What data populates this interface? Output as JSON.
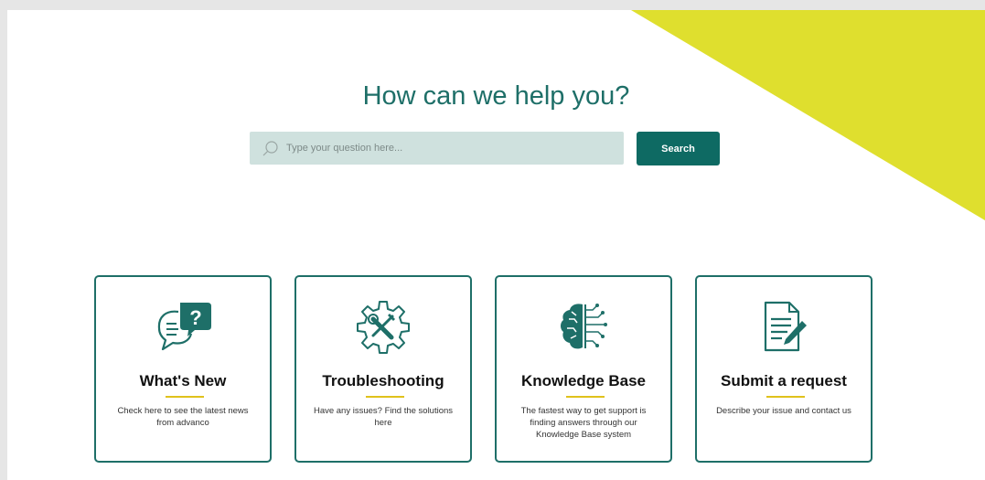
{
  "hero": {
    "title": "How can we help you?"
  },
  "search": {
    "placeholder": "Type your question here...",
    "button_label": "Search"
  },
  "colors": {
    "accent": "#dfdf2e",
    "brand": "#1e6f68",
    "button": "#0e6a63",
    "search_bg": "#cfe1de",
    "underline": "#e0c21c"
  },
  "cards": [
    {
      "icon": "chat-question-icon",
      "title": "What's New",
      "description": "Check here to see the latest news from advanco"
    },
    {
      "icon": "gear-tools-icon",
      "title": "Troubleshooting",
      "description": "Have any issues? Find the solutions here"
    },
    {
      "icon": "brain-circuit-icon",
      "title": "Knowledge Base",
      "description": "The fastest way to get support is finding answers through our Knowledge Base system"
    },
    {
      "icon": "document-pen-icon",
      "title": "Submit a request",
      "description": "Describe your issue and contact us"
    }
  ]
}
